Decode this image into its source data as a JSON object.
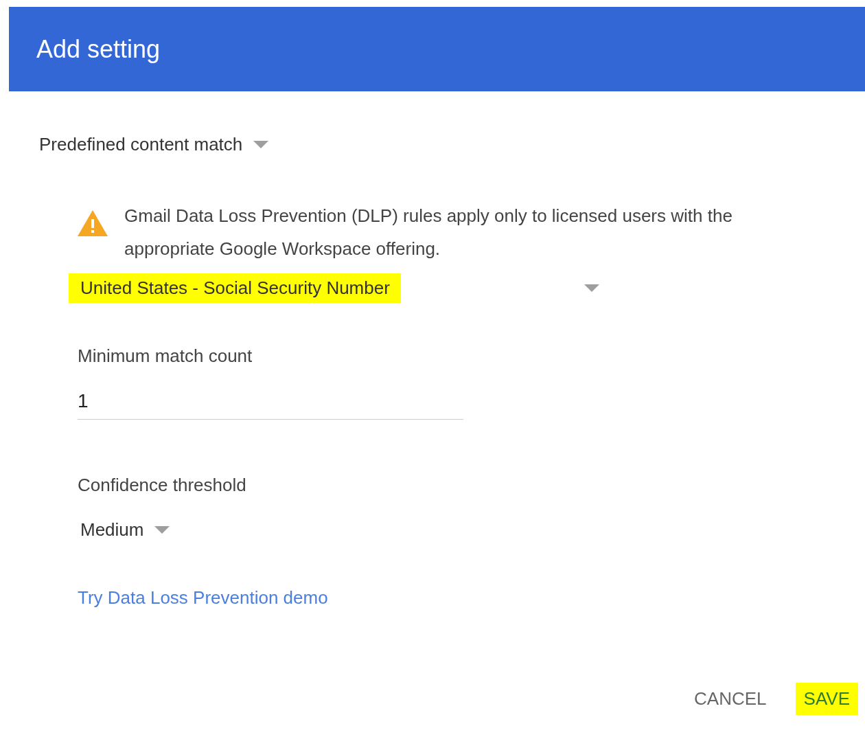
{
  "dialog": {
    "title": "Add setting"
  },
  "content_type": {
    "value": "Predefined content match"
  },
  "warning": {
    "text": "Gmail Data Loss Prevention (DLP) rules apply only to licensed users with the appropriate Google Workspace offering."
  },
  "detector": {
    "value": "United States - Social Security Number",
    "highlighted": true
  },
  "min_match": {
    "label": "Minimum match count",
    "value": "1"
  },
  "confidence": {
    "label": "Confidence threshold",
    "value": "Medium"
  },
  "demo_link": "Try Data Loss Prevention demo",
  "buttons": [
    {
      "label": "CANCEL",
      "kind": "flat",
      "highlighted": false
    },
    {
      "label": "SAVE",
      "kind": "primary",
      "highlighted": true
    }
  ]
}
